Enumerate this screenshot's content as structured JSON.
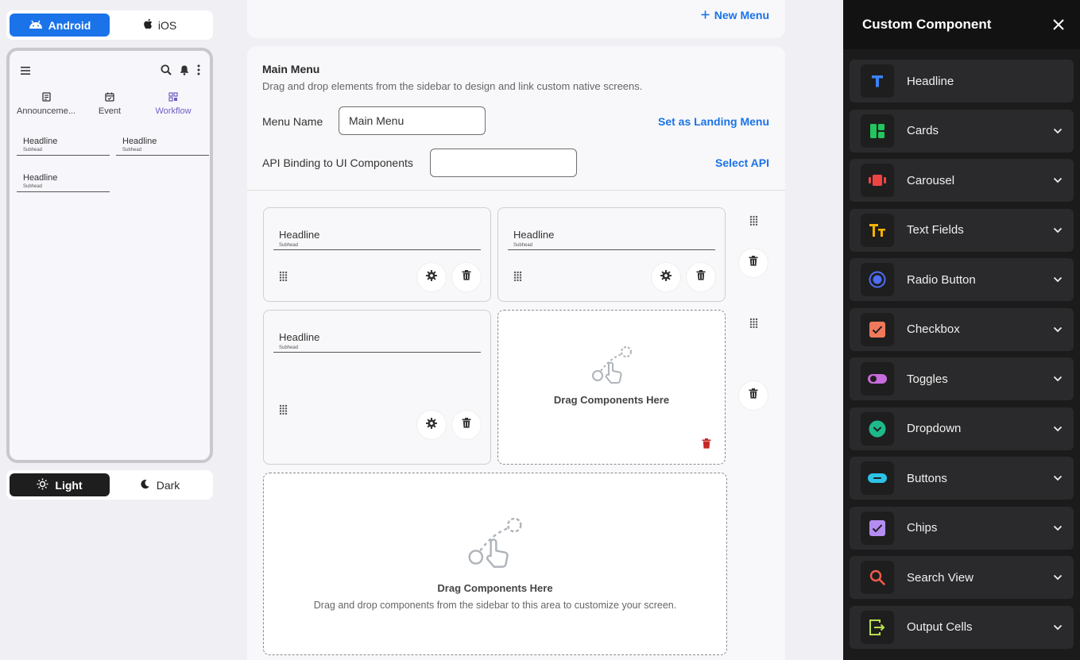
{
  "platform": {
    "android_label": "Android",
    "ios_label": "iOS",
    "selected": "Android"
  },
  "preview": {
    "tabs": [
      {
        "label": "Announceme...",
        "icon": "document-icon"
      },
      {
        "label": "Event",
        "icon": "calendar-icon"
      },
      {
        "label": "Workflow",
        "icon": "workflow-icon"
      }
    ],
    "cards": [
      {
        "headline": "Headline",
        "subhead": "Subhead"
      },
      {
        "headline": "Headline",
        "subhead": "Subhead"
      },
      {
        "headline": "Headline",
        "subhead": "Subhead"
      }
    ]
  },
  "theme": {
    "light_label": "Light",
    "dark_label": "Dark",
    "selected": "Light"
  },
  "toolbar": {
    "new_menu_label": "New Menu"
  },
  "editor": {
    "title": "Main Menu",
    "subtitle": "Drag and drop elements from the sidebar to design and link custom native screens.",
    "menu_name_label": "Menu Name",
    "menu_name_value": "Main Menu",
    "landing_link": "Set as Landing Menu",
    "api_label": "API Binding to UI Components",
    "api_value": "",
    "select_api_link": "Select API",
    "cards": [
      {
        "headline": "Headline",
        "subhead": "Subhead"
      },
      {
        "headline": "Headline",
        "subhead": "Subhead"
      },
      {
        "headline": "Headline",
        "subhead": "Subhead"
      }
    ],
    "drop_small_title": "Drag Components Here",
    "drop_large_title": "Drag Components Here",
    "drop_large_desc": "Drag and drop components from the sidebar to this area to customize your screen."
  },
  "sidebar": {
    "title": "Custom Component",
    "items": [
      {
        "label": "Headline",
        "icon": "headline-icon",
        "color": "#3b82f6",
        "expandable": false
      },
      {
        "label": "Cards",
        "icon": "cards-icon",
        "color": "#22c55e",
        "expandable": true
      },
      {
        "label": "Carousel",
        "icon": "carousel-icon",
        "color": "#ef4444",
        "expandable": true
      },
      {
        "label": "Text Fields",
        "icon": "text-fields-icon",
        "color": "#f5b301",
        "expandable": true
      },
      {
        "label": "Radio Button",
        "icon": "radio-button-icon",
        "color": "#4f6df5",
        "expandable": true
      },
      {
        "label": "Checkbox",
        "icon": "checkbox-icon",
        "color": "#f0795b",
        "expandable": true
      },
      {
        "label": "Toggles",
        "icon": "toggle-icon",
        "color": "#c86bdc",
        "expandable": true
      },
      {
        "label": "Dropdown",
        "icon": "dropdown-icon",
        "color": "#1db98b",
        "expandable": true
      },
      {
        "label": "Buttons",
        "icon": "buttons-icon",
        "color": "#2cc3e6",
        "expandable": true
      },
      {
        "label": "Chips",
        "icon": "chips-icon",
        "color": "#b48cf2",
        "expandable": true
      },
      {
        "label": "Search View",
        "icon": "search-view-icon",
        "color": "#f05a4a",
        "expandable": true
      },
      {
        "label": "Output Cells",
        "icon": "output-cells-icon",
        "color": "#b8e04a",
        "expandable": true
      }
    ]
  }
}
